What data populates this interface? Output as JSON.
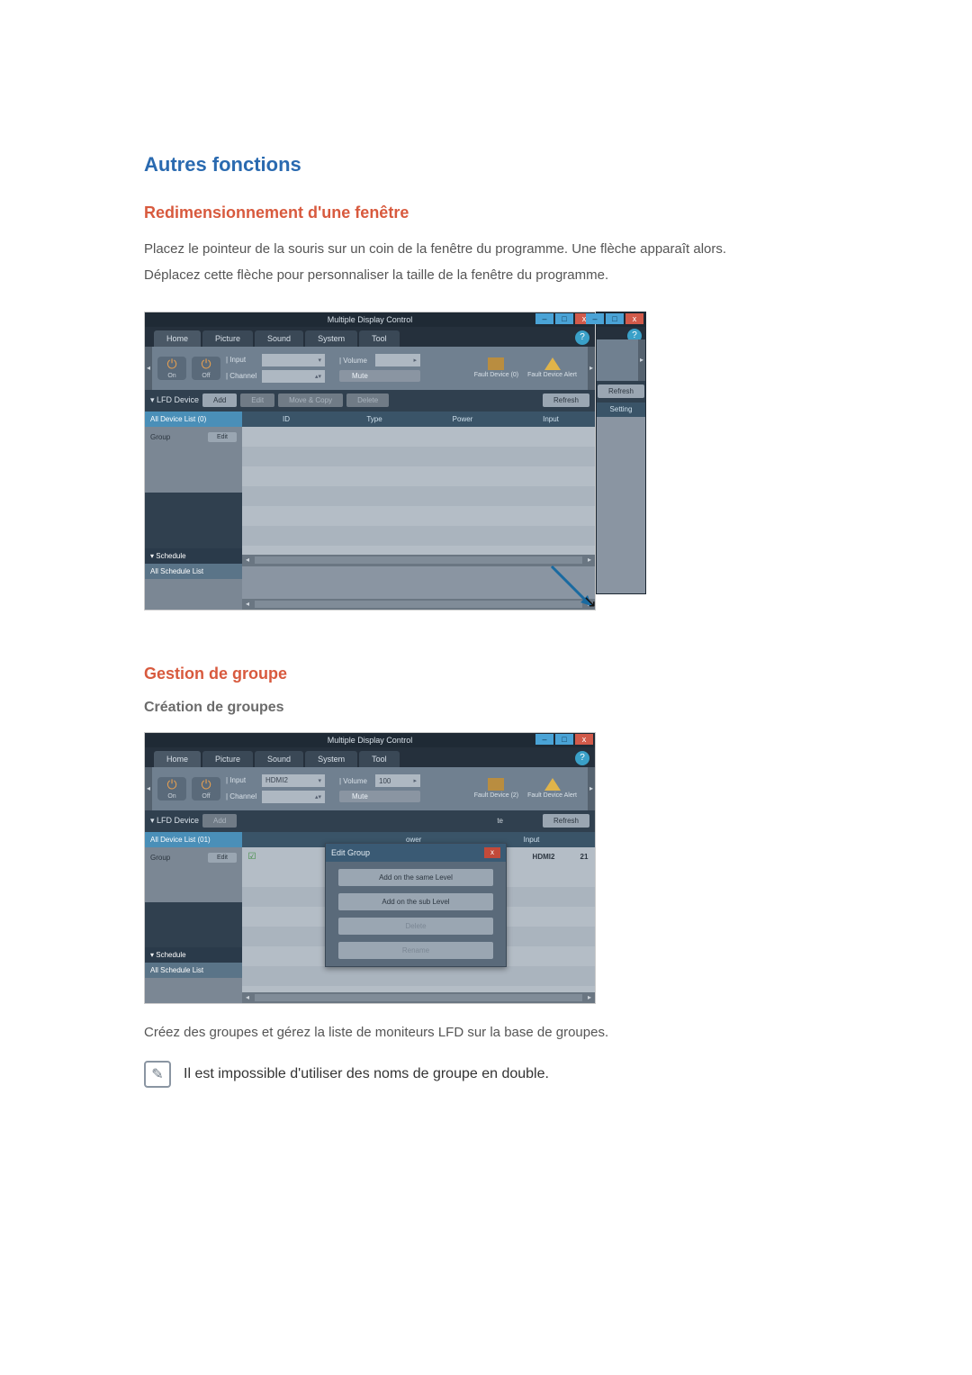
{
  "headings": {
    "section": "Autres fonctions",
    "resize": "Redimensionnement d'une fenêtre",
    "group": "Gestion de groupe",
    "create": "Création de groupes"
  },
  "paragraphs": {
    "resize1": "Placez le pointeur de la souris sur un coin de la fenêtre du programme. Une flèche apparaît alors.",
    "resize2": "Déplacez cette flèche pour personnaliser la taille de la fenêtre du programme.",
    "group1": "Créez des groupes et gérez la liste de moniteurs LFD sur la base de groupes.",
    "note": "Il est impossible d'utiliser des noms de groupe en double."
  },
  "app": {
    "title": "Multiple Display Control",
    "win_min": "–",
    "win_max": "□",
    "win_close": "x",
    "help": "?",
    "tabs": {
      "home": "Home",
      "picture": "Picture",
      "sound": "Sound",
      "system": "System",
      "tool": "Tool"
    },
    "power": {
      "on": "On",
      "off": "Off"
    },
    "fields": {
      "input": "| Input",
      "channel": "| Channel",
      "volume": "| Volume",
      "mute": "Mute",
      "input_val_empty": "",
      "input_val_hdmi2": "HDMI2",
      "volume_val_100": "100"
    },
    "status": {
      "fault_count": "Fault Device (0)",
      "fault_count2": "Fault Device (2)",
      "fault_alert": "Fault Device Alert"
    },
    "nav": {
      "lfd": "▾  LFD Device",
      "all0": "All Device List (0)",
      "all01": "All Device List (01)",
      "group": "Group",
      "edit": "Edit",
      "schedule": "▾  Schedule",
      "allsched": "All Schedule List"
    },
    "buttons": {
      "add": "Add",
      "edit": "Edit",
      "move": "Move & Copy",
      "delete": "Delete",
      "refresh": "Refresh"
    },
    "table": {
      "id": "ID",
      "type": "Type",
      "power": "Power",
      "input": "Input",
      "setting": "Setting"
    },
    "popup": {
      "title": "Edit Group",
      "close": "x",
      "same": "Add on the same Level",
      "sub": "Add on the sub Level",
      "delete": "Delete",
      "rename": "Rename"
    },
    "row": {
      "pwr_partial": "ower",
      "input_partial": "te",
      "hdmi2": "HDMI2",
      "num": "21",
      "input": "Input"
    }
  }
}
